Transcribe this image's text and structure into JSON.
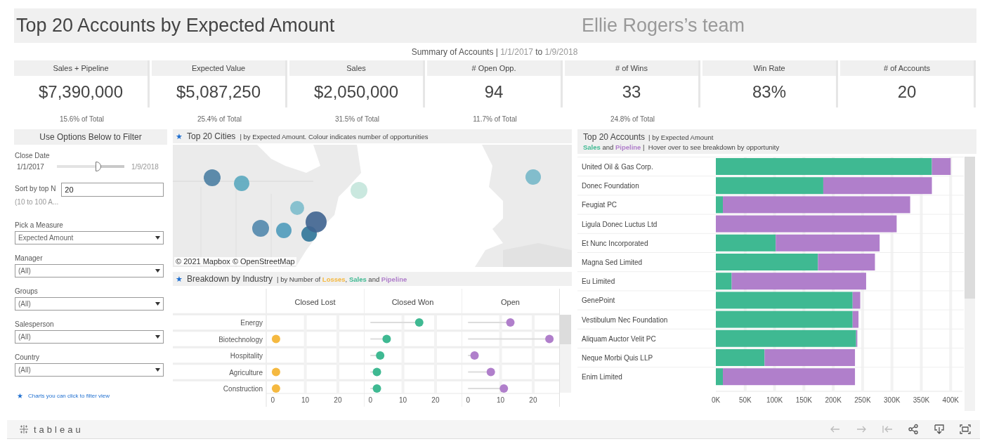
{
  "dashboard": {
    "title": "Top 20 Accounts by Expected Amount",
    "team": "Ellie Rogers’s team"
  },
  "summary": {
    "label": "Summary of Accounts |",
    "from": "1/1/2017",
    "joiner": "to",
    "to": "1/9/2018"
  },
  "kpis": [
    {
      "label": "Sales + Pipeline",
      "value": "$7,390,000",
      "share": "15.6% of Total"
    },
    {
      "label": "Expected Value",
      "value": "$5,087,250",
      "share": "25.4% of Total"
    },
    {
      "label": "Sales",
      "value": "$2,050,000",
      "share": "31.5% of Total"
    },
    {
      "label": "# Open Opp.",
      "value": "94",
      "share": "11.7% of Total"
    },
    {
      "label": "# of Wins",
      "value": "33",
      "share": "24.8% of Total"
    },
    {
      "label": "Win Rate",
      "value": "83%"
    },
    {
      "label": "# of Accounts",
      "value": "20"
    }
  ],
  "filters": {
    "heading": "Use Options Below to Filter",
    "close_date": {
      "label": "Close Date",
      "from": "1/1/2017",
      "to": "1/9/2018",
      "level": 0.62
    },
    "top_n": {
      "label": "Sort by top N",
      "hint": "(10 to 100 A...",
      "value": "20"
    },
    "dropdowns": [
      {
        "label": "Pick a Measure",
        "value": "Expected Amount"
      },
      {
        "label": "Manager",
        "value": "(All)"
      },
      {
        "label": "Groups",
        "value": "(All)"
      },
      {
        "label": "Salesperson",
        "value": "(All)"
      },
      {
        "label": "Country",
        "value": "(All)"
      }
    ],
    "note": {
      "icon": "★",
      "text": "Charts you can click to filter view"
    }
  },
  "cities": {
    "star": "★",
    "title": "Top 20 Cities",
    "subtitle": "| by  Expected Amount. Colour indicates number of opportunities",
    "attribution": "© 2021 Mapbox  © OpenStreetMap"
  },
  "industry": {
    "star": "★",
    "title": "Breakdown by Industry",
    "subtitle_lead": "| by Number of ",
    "subtitle_joiners": [
      ", ",
      " and "
    ],
    "panels": [
      {
        "chart_data": {
          "type": "scatter",
          "orientation": "horizontal",
          "title": "Closed Lost",
          "categories": [
            "Energy",
            "Biotechnology",
            "Hospitality",
            "Agriculture",
            "Construction"
          ],
          "series": [
            {
              "name": "Losses",
              "color": "#f5b940",
              "values": [
                null,
                1,
                null,
                1,
                1
              ]
            }
          ],
          "xlim": [
            -2,
            28
          ],
          "xticks": [
            0,
            10,
            20
          ],
          "grid": true
        }
      },
      {
        "chart_data": {
          "type": "scatter",
          "orientation": "horizontal",
          "title": "Closed Won",
          "series": [
            {
              "name": "Sales",
              "color": "#3fb992",
              "values": [
                15,
                5,
                3,
                2,
                2
              ]
            }
          ],
          "xlim": [
            -2,
            28
          ],
          "xticks": [
            0,
            10,
            20
          ],
          "grid": true
        }
      },
      {
        "chart_data": {
          "type": "scatter",
          "orientation": "horizontal",
          "title": "Open",
          "series": [
            {
              "name": "Pipeline",
              "color": "#b07fcb",
              "values": [
                13,
                25,
                2,
                7,
                11
              ]
            }
          ],
          "xlim": [
            -2,
            28
          ],
          "xticks": [
            0,
            10,
            20
          ],
          "grid": true
        }
      }
    ]
  },
  "accounts": {
    "title": "Top 20 Accounts",
    "subtitle": "| by  Expected Amount",
    "legend_joiner": " and ",
    "legend_note": " |  Hover over to see breakdown by opportunity",
    "chart_data": {
      "type": "bar",
      "orientation": "horizontal",
      "stacked": true,
      "grid": true,
      "categories": [
        "United Oil & Gas Corp.",
        "Donec Foundation",
        "Feugiat PC",
        "Ligula Donec Luctus Ltd",
        "Et Nunc Incorporated",
        "Magna Sed Limited",
        "Eu Limited",
        "GenePoint",
        "Vestibulum Nec Foundation",
        "Aliquam Auctor Velit PC",
        "Neque Morbi Quis LLP",
        "Enim Limited"
      ],
      "series": [
        {
          "name": "Sales",
          "color": "#3fb992",
          "values": [
            368000,
            183000,
            12000,
            0,
            102000,
            174000,
            27000,
            233000,
            233000,
            239000,
            83000,
            12000
          ]
        },
        {
          "name": "Pipeline",
          "color": "#b07fcb",
          "values": [
            32000,
            185000,
            319000,
            308000,
            177000,
            97000,
            229000,
            13000,
            10000,
            2000,
            154000,
            225000
          ]
        }
      ],
      "xlim": [
        0,
        420000
      ],
      "xticks": [
        {
          "value": 0,
          "label": "0K"
        },
        {
          "value": 50000,
          "label": "50K"
        },
        {
          "value": 100000,
          "label": "100K"
        },
        {
          "value": 150000,
          "label": "150K"
        },
        {
          "value": 200000,
          "label": "200K"
        },
        {
          "value": 250000,
          "label": "250K"
        },
        {
          "value": 300000,
          "label": "300K"
        },
        {
          "value": 350000,
          "label": "350K"
        },
        {
          "value": 400000,
          "label": "400K"
        }
      ]
    }
  },
  "footer": {
    "logo": "tableau"
  }
}
